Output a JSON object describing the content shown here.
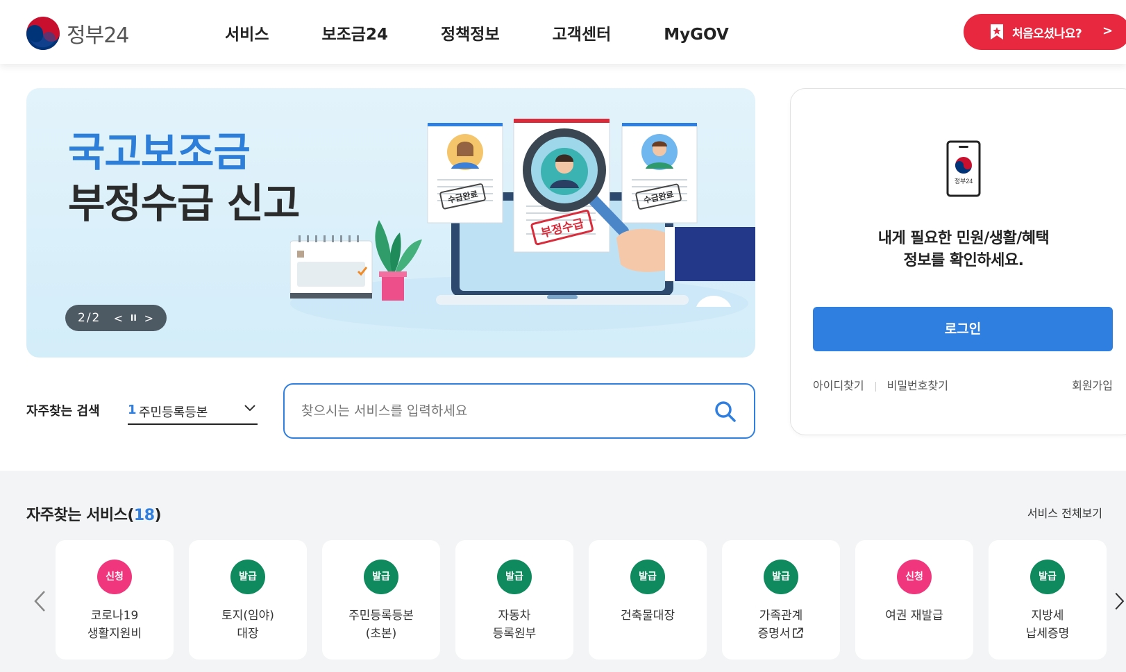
{
  "header": {
    "logo_text": "정부24",
    "nav": [
      "서비스",
      "보조금24",
      "정책정보",
      "고객센터",
      "MyGOV"
    ],
    "cta_label": "처음오셨나요?",
    "cta_chevron": ">"
  },
  "banner": {
    "title_line1": "국고보조금",
    "title_line2": "부정수급 신고",
    "stamp_done": "수급완료",
    "stamp_fraud": "부정수급",
    "slide_counter": "2/2",
    "prev_label": "<",
    "pause_label": "II",
    "next_label": ">"
  },
  "login": {
    "phone_label": "정부24",
    "message_line1": "내게 필요한 민원/생활/혜택",
    "message_line2": "정보를 확인하세요.",
    "button": "로그인",
    "find_id": "아이디찾기",
    "find_pw": "비밀번호찾기",
    "signup": "회원가입"
  },
  "search": {
    "freq_label": "자주찾는 검색",
    "freq_rank": "1",
    "freq_value": "주민등록등본",
    "placeholder": "찾으시는 서비스를 입력하세요"
  },
  "services": {
    "title": "자주찾는 서비스(",
    "count": "18",
    "title_end": ")",
    "view_all": "서비스 전체보기",
    "items": [
      {
        "badge": "신청",
        "type": "apply",
        "line1": "코로나19",
        "line2": "생활지원비"
      },
      {
        "badge": "발급",
        "type": "issue",
        "line1": "토지(임야)",
        "line2": "대장"
      },
      {
        "badge": "발급",
        "type": "issue",
        "line1": "주민등록등본",
        "line2": "(초본)"
      },
      {
        "badge": "발급",
        "type": "issue",
        "line1": "자동차",
        "line2": "등록원부"
      },
      {
        "badge": "발급",
        "type": "issue",
        "line1": "건축물대장",
        "line2": ""
      },
      {
        "badge": "발급",
        "type": "issue",
        "line1": "가족관계",
        "line2": "증명서"
      },
      {
        "badge": "신청",
        "type": "apply",
        "line1": "여권 재발급",
        "line2": ""
      },
      {
        "badge": "발급",
        "type": "issue",
        "line1": "지방세",
        "line2": "납세증명"
      }
    ]
  },
  "colors": {
    "primary_blue": "#2f7fe0",
    "cta_red": "#e8283e",
    "apply_pink": "#f0367d",
    "issue_green": "#0f8a5f"
  },
  "icons": [
    "taegeuk-logo-icon",
    "bookmark-star-icon",
    "search-icon",
    "chevron-down-icon",
    "phone-app-icon",
    "external-link-icon",
    "arrow-left-icon",
    "arrow-right-icon"
  ]
}
